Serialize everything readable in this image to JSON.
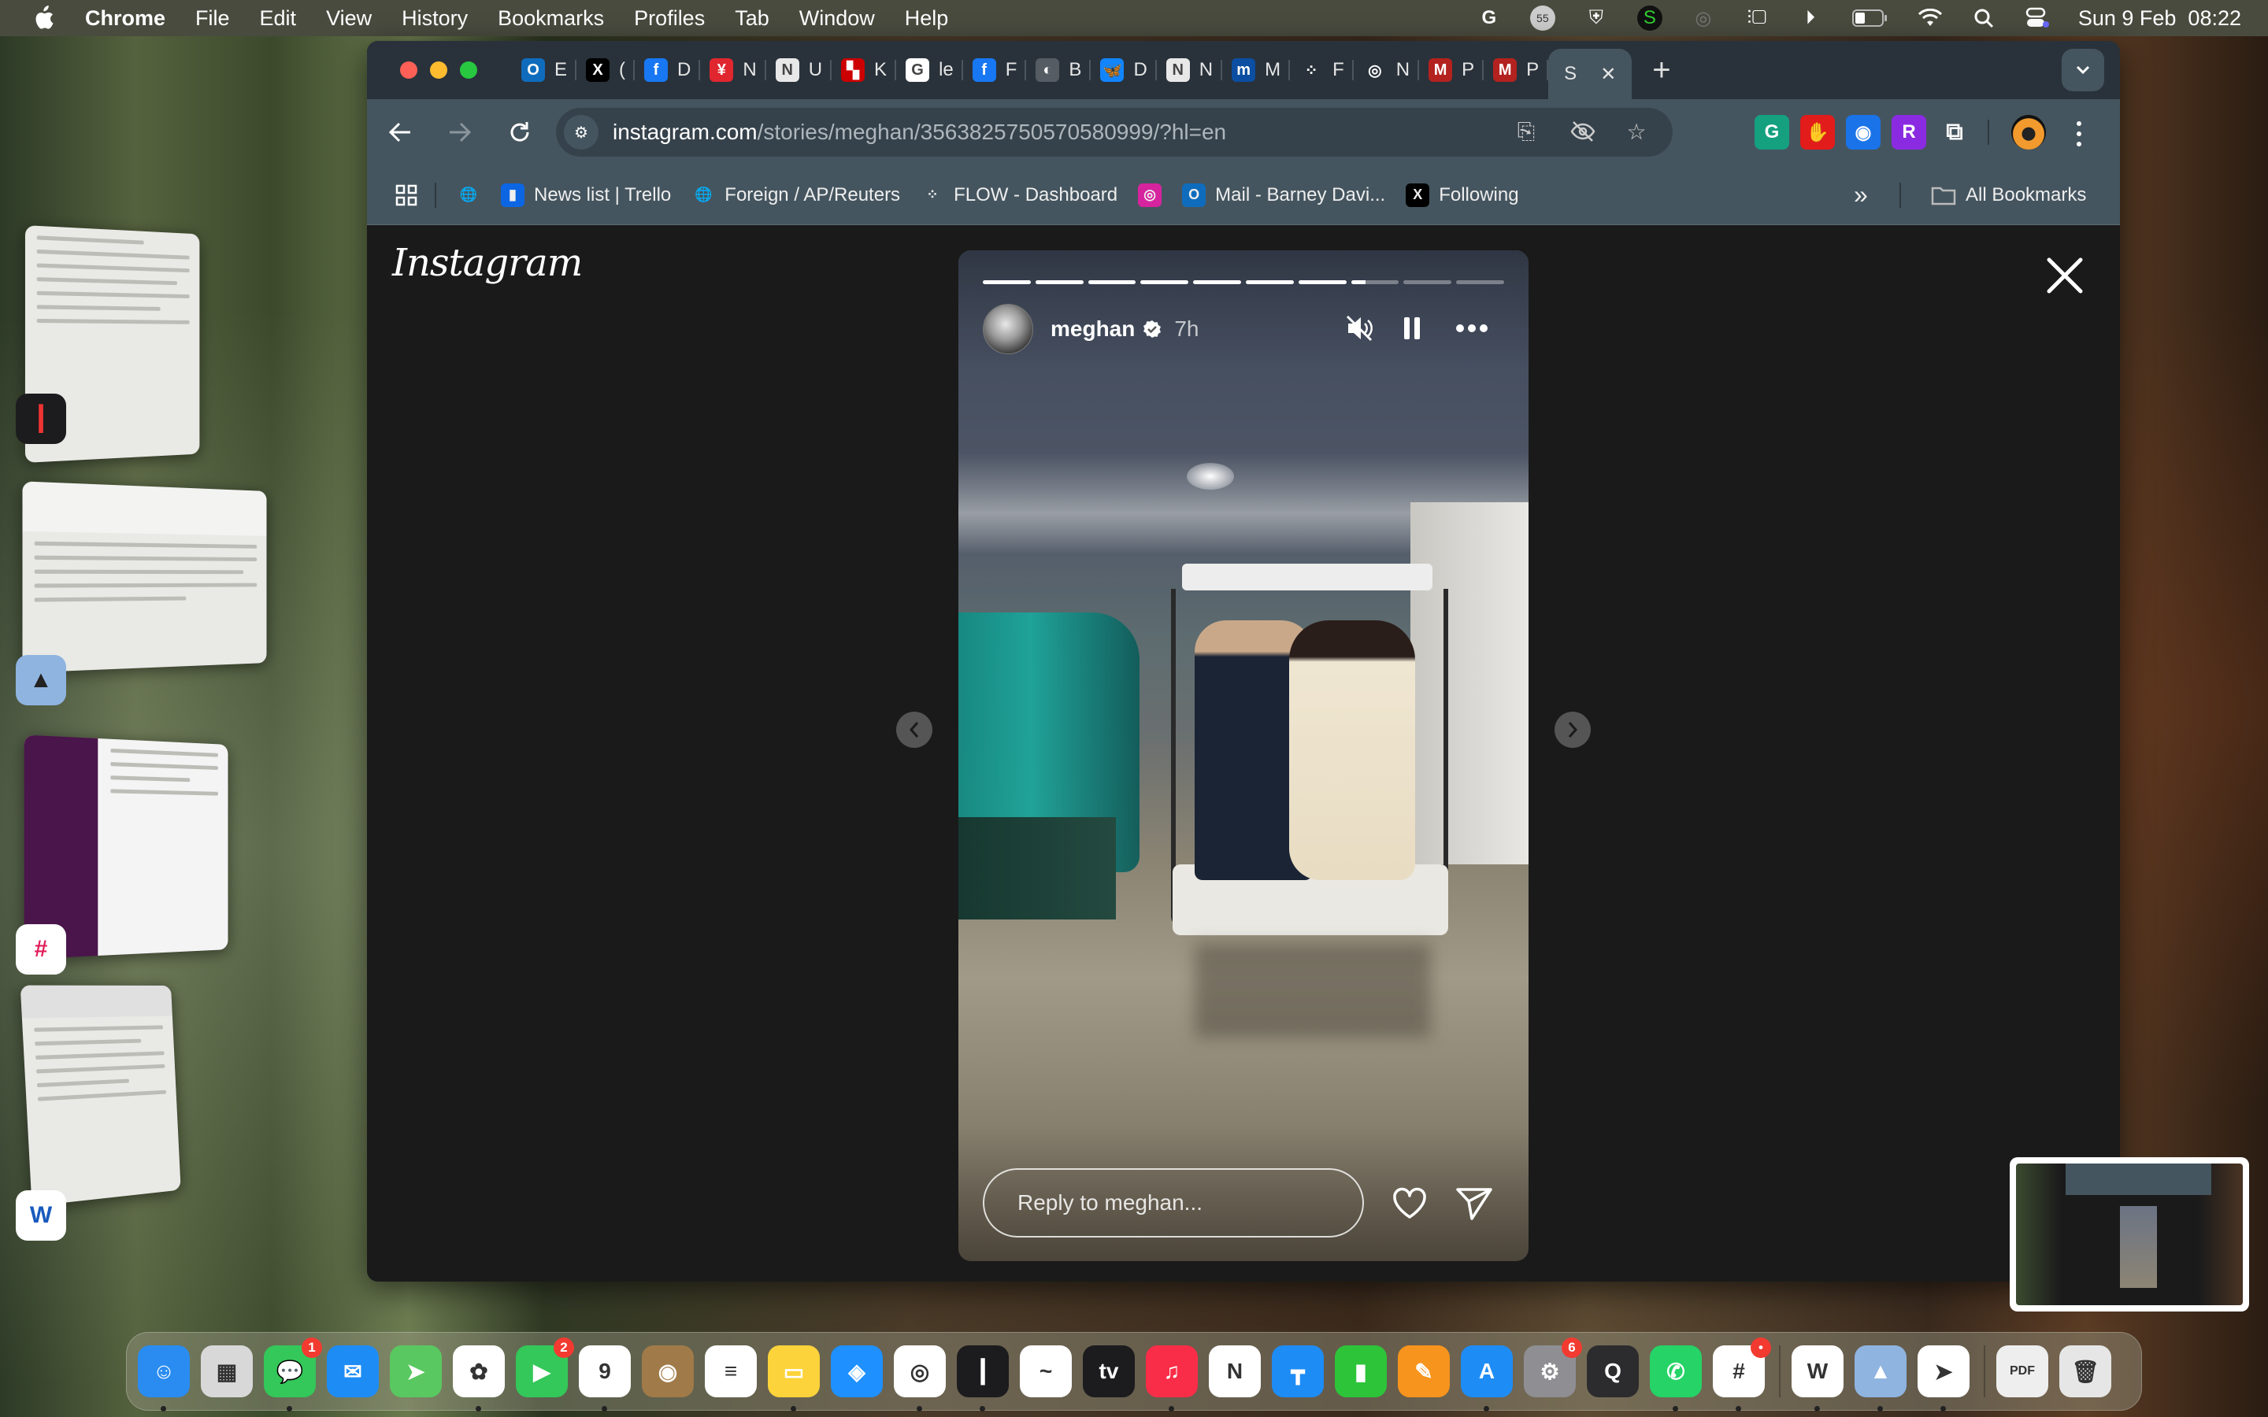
{
  "menubar": {
    "app_name": "Chrome",
    "items": [
      "File",
      "Edit",
      "View",
      "History",
      "Bookmarks",
      "Profiles",
      "Tab",
      "Window",
      "Help"
    ],
    "status_icons": [
      "grammarly-icon",
      "notifications-55-icon",
      "shield-icon",
      "s-app-icon",
      "airdrop-icon",
      "stage-manager-icon",
      "play-icon",
      "battery-icon",
      "wifi-icon",
      "spotlight-icon",
      "control-center-icon"
    ],
    "notification_count": "55",
    "datetime": "Sun 9 Feb  08:22"
  },
  "stage_manager": {
    "windows": [
      {
        "app": "Voice Memos",
        "icon": "voice-memos-icon"
      },
      {
        "app": "Preview",
        "icon": "preview-icon"
      },
      {
        "app": "Slack",
        "icon": "slack-icon"
      },
      {
        "app": "Word",
        "icon": "word-icon"
      }
    ]
  },
  "browser": {
    "tabs": [
      {
        "letter": "E",
        "icon": "outlook-icon",
        "color": "#0f6cbd",
        "glyph": "O"
      },
      {
        "letter": "(",
        "icon": "x-icon",
        "color": "#000000",
        "glyph": "X"
      },
      {
        "letter": "D",
        "icon": "facebook-icon",
        "color": "#1877f2",
        "glyph": "f"
      },
      {
        "letter": "N",
        "icon": "independent-icon",
        "color": "#e0262f",
        "glyph": "¥"
      },
      {
        "letter": "U",
        "icon": "notion-n-icon",
        "color": "#e8e8e8",
        "glyph": "N"
      },
      {
        "letter": "K",
        "icon": "red-blocks-icon",
        "color": "#cc0000",
        "glyph": "▚"
      },
      {
        "letter": "le",
        "icon": "google-icon",
        "color": "#ffffff",
        "glyph": "G"
      },
      {
        "letter": "F",
        "icon": "facebook-icon",
        "color": "#1877f2",
        "glyph": "f"
      },
      {
        "letter": "B",
        "icon": "globe-icon",
        "color": "#555c63",
        "glyph": "◐"
      },
      {
        "letter": "D",
        "icon": "bluesky-icon",
        "color": "#1185fe",
        "glyph": "🦋"
      },
      {
        "letter": "N",
        "icon": "notion-n-icon",
        "color": "#e8e8e8",
        "glyph": "N"
      },
      {
        "letter": "M",
        "icon": "m-blackletter-icon",
        "color": "#0b4ea2",
        "glyph": "m"
      },
      {
        "letter": "F",
        "icon": "flow-icon",
        "color": "#29323a",
        "glyph": "⁘"
      },
      {
        "letter": "N",
        "icon": "chrome-icon",
        "color": "#29323a",
        "glyph": "◎"
      },
      {
        "letter": "P",
        "icon": "m-red-icon",
        "color": "#b3221f",
        "glyph": "M"
      },
      {
        "letter": "P",
        "icon": "m-red-icon",
        "color": "#b3221f",
        "glyph": "M"
      }
    ],
    "active_tab": {
      "letter": "S",
      "close": "✕"
    },
    "new_tab": "+",
    "url_host": "instagram.com",
    "url_path": "/stories/meghan/3563825750570580999/?hl=en",
    "extensions": [
      {
        "name": "grammarly-ext-icon",
        "color": "#15a080",
        "glyph": "G"
      },
      {
        "name": "adblock-ext-icon",
        "color": "#e21b1b",
        "glyph": "✋"
      },
      {
        "name": "screen-capture-ext-icon",
        "color": "#1a73e8",
        "glyph": "◉"
      },
      {
        "name": "r-ext-icon",
        "color": "#8a2be2",
        "glyph": "R"
      },
      {
        "name": "extensions-puzzle-icon",
        "color": "transparent",
        "glyph": "⧉"
      }
    ],
    "bookmarks": [
      {
        "label": "",
        "icon": "globe-icon"
      },
      {
        "label": "News list | Trello",
        "icon": "trello-icon"
      },
      {
        "label": "Foreign / AP/Reuters",
        "icon": "globe-icon"
      },
      {
        "label": "FLOW - Dashboard",
        "icon": "flow-icon"
      },
      {
        "label": "",
        "icon": "instagram-icon"
      },
      {
        "label": "Mail - Barney Davi...",
        "icon": "outlook-icon"
      },
      {
        "label": "Following",
        "icon": "x-icon"
      }
    ],
    "bookmarks_overflow": "»",
    "all_bookmarks": "All Bookmarks"
  },
  "instagram": {
    "logo": "Instagram",
    "story": {
      "username": "meghan",
      "verified": true,
      "time_ago": "7h",
      "segments_total": 10,
      "segments_complete": 7,
      "current_segment_progress": 0.3,
      "reply_placeholder": "Reply to meghan...",
      "muted": true,
      "paused": false
    }
  },
  "dock": {
    "apps": [
      {
        "name": "Finder",
        "icon": "finder-icon",
        "color": "#2a8cf0",
        "glyph": "☺",
        "running": true
      },
      {
        "name": "Launchpad",
        "icon": "launchpad-icon",
        "color": "#d8d8d8",
        "glyph": "▦",
        "running": false
      },
      {
        "name": "Messages",
        "icon": "messages-icon",
        "color": "#34c759",
        "glyph": "💬",
        "badge": "1",
        "running": true
      },
      {
        "name": "Mail",
        "icon": "mail-icon",
        "color": "#1e8cf5",
        "glyph": "✉",
        "running": false
      },
      {
        "name": "Maps",
        "icon": "maps-icon",
        "color": "#5ac860",
        "glyph": "➤",
        "running": false
      },
      {
        "name": "Photos",
        "icon": "photos-icon",
        "color": "#ffffff",
        "glyph": "✿",
        "running": true
      },
      {
        "name": "FaceTime",
        "icon": "facetime-icon",
        "color": "#34c759",
        "glyph": "▶",
        "badge": "2",
        "running": false
      },
      {
        "name": "Calendar",
        "icon": "calendar-icon",
        "color": "#ffffff",
        "glyph": "9",
        "running": true
      },
      {
        "name": "Contacts",
        "icon": "contacts-icon",
        "color": "#a07a48",
        "glyph": "◉",
        "running": false
      },
      {
        "name": "Reminders",
        "icon": "reminders-icon",
        "color": "#ffffff",
        "glyph": "≡",
        "running": false
      },
      {
        "name": "Notes",
        "icon": "notes-icon",
        "color": "#fcd33a",
        "glyph": "▭",
        "running": true
      },
      {
        "name": "Safari",
        "icon": "safari-icon",
        "color": "#1e90ff",
        "glyph": "◈",
        "running": false
      },
      {
        "name": "Chrome",
        "icon": "chrome-icon",
        "color": "#ffffff",
        "glyph": "◎",
        "running": true
      },
      {
        "name": "Voice Memos",
        "icon": "voice-memos-icon",
        "color": "#1c1c1e",
        "glyph": "┃",
        "running": true
      },
      {
        "name": "Freeform",
        "icon": "freeform-icon",
        "color": "#ffffff",
        "glyph": "~",
        "running": false
      },
      {
        "name": "TV",
        "icon": "apple-tv-icon",
        "color": "#1c1c1e",
        "glyph": "tv",
        "running": false
      },
      {
        "name": "Music",
        "icon": "music-icon",
        "color": "#fa2d48",
        "glyph": "♫",
        "running": true
      },
      {
        "name": "News",
        "icon": "news-icon",
        "color": "#ffffff",
        "glyph": "N",
        "running": false
      },
      {
        "name": "Keynote",
        "icon": "keynote-icon",
        "color": "#1e8cf5",
        "glyph": "┳",
        "running": false
      },
      {
        "name": "Numbers",
        "icon": "numbers-icon",
        "color": "#2dc43a",
        "glyph": "▮",
        "running": false
      },
      {
        "name": "Pages",
        "icon": "pages-icon",
        "color": "#f7941d",
        "glyph": "✎",
        "running": false
      },
      {
        "name": "App Store",
        "icon": "app-store-icon",
        "color": "#1e8cf5",
        "glyph": "A",
        "running": true
      },
      {
        "name": "System Settings",
        "icon": "settings-gear-icon",
        "color": "#8e8e93",
        "glyph": "⚙",
        "badge": "6",
        "running": false
      },
      {
        "name": "QuickTime",
        "icon": "quicktime-icon",
        "color": "#2c2c2e",
        "glyph": "Q",
        "running": false
      },
      {
        "name": "WhatsApp",
        "icon": "whatsapp-icon",
        "color": "#25d366",
        "glyph": "✆",
        "running": true
      },
      {
        "name": "Slack",
        "icon": "slack-icon",
        "color": "#ffffff",
        "glyph": "#",
        "badge": "•",
        "running": true
      }
    ],
    "recent_apps": [
      {
        "name": "Word",
        "icon": "word-icon",
        "color": "#ffffff",
        "glyph": "W",
        "running": true
      },
      {
        "name": "Preview",
        "icon": "preview-icon",
        "color": "#8fb4e0",
        "glyph": "▲",
        "running": true
      },
      {
        "name": "Telegram",
        "icon": "telegram-icon",
        "color": "#ffffff",
        "glyph": "➤",
        "running": true
      }
    ],
    "trailing": [
      {
        "name": "Downloads PDF",
        "icon": "pdf-stack-icon",
        "color": "#eeeeee",
        "glyph": "PDF"
      },
      {
        "name": "Trash",
        "icon": "trash-icon",
        "color": "#e6e6e6",
        "glyph": "🗑"
      }
    ]
  }
}
